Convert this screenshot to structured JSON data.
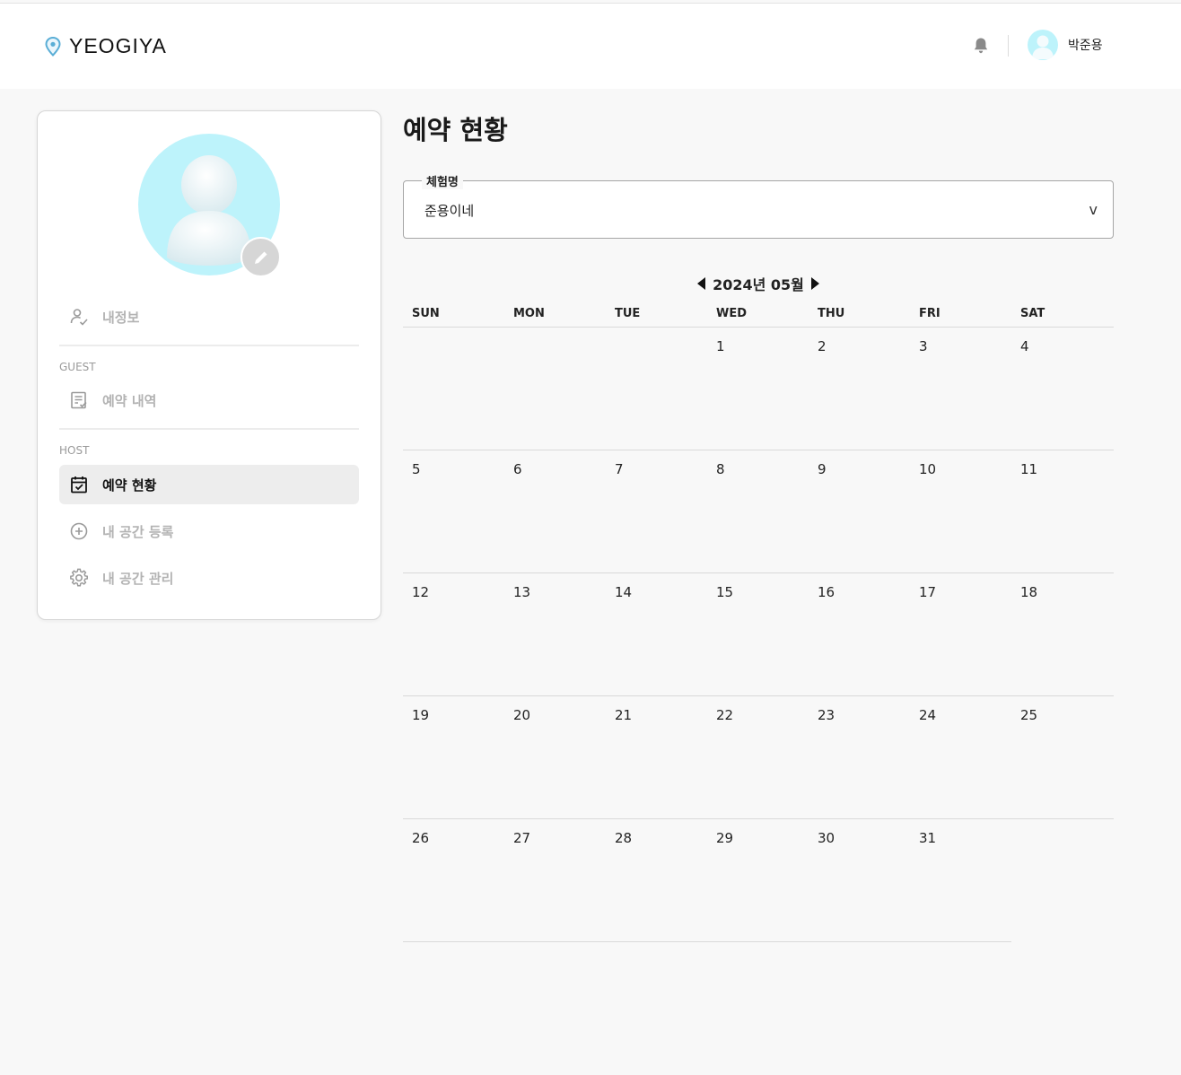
{
  "app": {
    "logo_text": "YEOGIYA"
  },
  "header": {
    "user_name": "박준용"
  },
  "sidebar": {
    "my_info": "내정보",
    "guest_section": "GUEST",
    "reservation_history": "예약 내역",
    "host_section": "HOST",
    "reservation_status": "예약 현황",
    "register_space": "내 공간 등록",
    "manage_space": "내 공간 관리"
  },
  "main": {
    "title": "예약 현황",
    "select": {
      "label": "체험명",
      "value": "준용이네",
      "arrow": "v"
    }
  },
  "calendar": {
    "month_label": "2024년 05월",
    "weekdays": [
      "SUN",
      "MON",
      "TUE",
      "WED",
      "THU",
      "FRI",
      "SAT"
    ],
    "weeks": [
      [
        "",
        "",
        "",
        "1",
        "2",
        "3",
        "4"
      ],
      [
        "5",
        "6",
        "7",
        "8",
        "9",
        "10",
        "11"
      ],
      [
        "12",
        "13",
        "14",
        "15",
        "16",
        "17",
        "18"
      ],
      [
        "19",
        "20",
        "21",
        "22",
        "23",
        "24",
        "25"
      ],
      [
        "26",
        "27",
        "28",
        "29",
        "30",
        "31",
        ""
      ]
    ]
  },
  "colors": {
    "avatar_bg": "#bdf3fb",
    "logo_pin": "#5aaed6",
    "active_menu_bg": "#ededed",
    "page_bg": "#f8f8f8"
  }
}
